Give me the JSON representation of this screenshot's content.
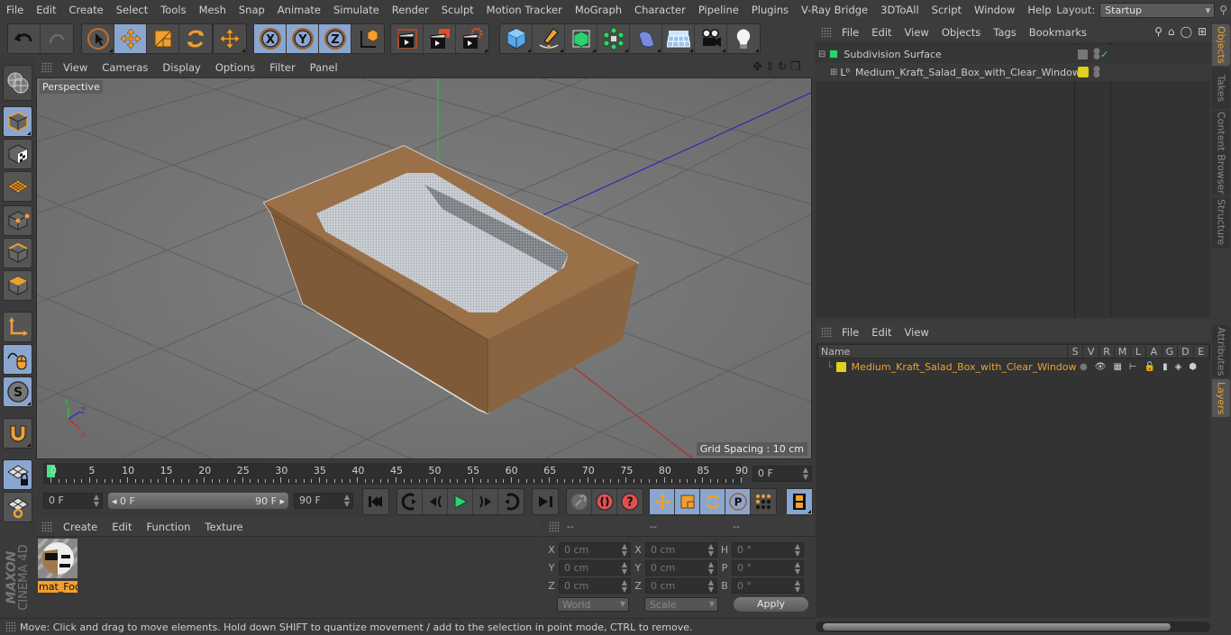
{
  "menubar": {
    "items": [
      "File",
      "Edit",
      "Create",
      "Select",
      "Tools",
      "Mesh",
      "Snap",
      "Animate",
      "Simulate",
      "Render",
      "Sculpt",
      "Motion Tracker",
      "MoGraph",
      "Character",
      "Pipeline",
      "Plugins",
      "V-Ray Bridge",
      "3DToAll",
      "Script",
      "Window",
      "Help"
    ],
    "layout_label": "Layout:",
    "layout_value": "Startup"
  },
  "toolbar": {
    "groups": [
      {
        "name": "history",
        "items": [
          "undo-icon",
          "redo-icon"
        ]
      },
      {
        "name": "tools",
        "items": [
          "live-selection-icon",
          "move-icon",
          "scale-icon",
          "rotate-icon"
        ]
      },
      {
        "name": "recent",
        "items": [
          "recent-tool-icon"
        ]
      },
      {
        "name": "axes",
        "items": [
          "x-axis-lock-icon",
          "y-axis-lock-icon",
          "z-axis-lock-icon",
          "coordinate-system-icon"
        ]
      },
      {
        "name": "render",
        "items": [
          "render-view-icon",
          "render-to-picture-viewer-icon",
          "render-settings-icon"
        ]
      },
      {
        "name": "create",
        "items": [
          "cube-icon",
          "pen-spline-icon",
          "subdivision-surface-icon",
          "cloner-icon",
          "deformer-icon",
          "floor-icon",
          "camera-icon",
          "light-icon"
        ]
      }
    ]
  },
  "left_toolbar": {
    "items": [
      "make-editable-icon",
      "model-mode-icon",
      "texture-mode-icon",
      "workplane-icon",
      "points-mode-icon",
      "edges-mode-icon",
      "polygons-mode-icon",
      "axis-mode-icon",
      "tweak-mode-icon",
      "snap-icon",
      "magnet-icon",
      "lock-workplane-icon",
      "planar-workplane-icon"
    ]
  },
  "viewport": {
    "menu": [
      "View",
      "Cameras",
      "Display",
      "Options",
      "Filter",
      "Panel"
    ],
    "camera_label": "Perspective",
    "grid_spacing": "Grid Spacing : 10 cm",
    "axis_labels": {
      "x": "X",
      "y": "Y",
      "z": "Z"
    }
  },
  "timeline": {
    "ticks": [
      "0",
      "5",
      "10",
      "15",
      "20",
      "25",
      "30",
      "35",
      "40",
      "45",
      "50",
      "55",
      "60",
      "65",
      "70",
      "75",
      "80",
      "85",
      "90"
    ],
    "current_frame_field": "0 F",
    "start_field": "0 F",
    "range_start": "0 F",
    "range_end": "90 F",
    "end_field": "90 F",
    "current_frame": 0,
    "total_frames": 90
  },
  "materials": {
    "menu": [
      "Create",
      "Edit",
      "Function",
      "Texture"
    ],
    "items": [
      {
        "name": "mat_Foc"
      }
    ]
  },
  "coordinates": {
    "headers": [
      "--",
      "--",
      "--"
    ],
    "rows": [
      {
        "a": "X",
        "av": "0 cm",
        "b": "X",
        "bv": "0 cm",
        "c": "H",
        "cv": "0 °"
      },
      {
        "a": "Y",
        "av": "0 cm",
        "b": "Y",
        "bv": "0 cm",
        "c": "P",
        "cv": "0 °"
      },
      {
        "a": "Z",
        "av": "0 cm",
        "b": "Z",
        "bv": "0 cm",
        "c": "B",
        "cv": "0 °"
      }
    ],
    "mode_select": "World",
    "transform_select": "Scale",
    "apply_label": "Apply"
  },
  "status": {
    "text": "Move: Click and drag to move elements. Hold down SHIFT to quantize movement / add to the selection in point mode, CTRL to remove."
  },
  "objects_panel": {
    "menu": [
      "File",
      "Edit",
      "View",
      "Objects",
      "Tags",
      "Bookmarks"
    ],
    "objects": [
      {
        "name": "Subdivision Surface",
        "level": 0,
        "expanded": true,
        "icon": "subdivision-surface-icon"
      },
      {
        "name": "Medium_Kraft_Salad_Box_with_Clear_Window",
        "level": 1,
        "expanded": false,
        "icon": "null-object-icon",
        "layer_color": "#e0d020"
      }
    ]
  },
  "layers_panel": {
    "menu": [
      "File",
      "Edit",
      "View"
    ],
    "columns": [
      "Name",
      "S",
      "V",
      "R",
      "M",
      "L",
      "A",
      "G",
      "D",
      "E"
    ],
    "layers": [
      {
        "name": "Medium_Kraft_Salad_Box_with_Clear_Window",
        "color": "#e0d020"
      }
    ]
  },
  "side_tabs": {
    "top": [
      "Objects",
      "Takes",
      "Content Browser",
      "Structure"
    ],
    "bottom": [
      "Attributes",
      "Layers"
    ],
    "active_top": "Objects",
    "active_bottom": "Layers"
  },
  "branding": {
    "text1": "MAXON",
    "text2": "CINEMA 4D"
  },
  "colors": {
    "accent": "#f0a030",
    "active_button": "#8aa6cf",
    "playhead": "#4ce08a"
  }
}
